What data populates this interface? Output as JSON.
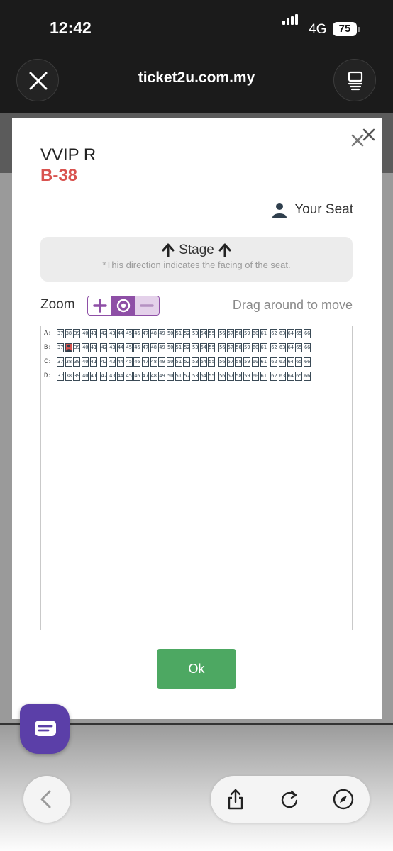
{
  "status_bar": {
    "time": "12:42",
    "network": "4G",
    "battery": "75"
  },
  "browser": {
    "url": "ticket2u.com.my"
  },
  "seat_info": {
    "zone": "VVIP R",
    "seat_code": "B-38"
  },
  "legend": {
    "your_seat_label": "Your Seat"
  },
  "stage": {
    "label": "Stage",
    "note": "*This direction indicates the facing of the seat."
  },
  "zoom": {
    "label": "Zoom",
    "drag_hint": "Drag around to move"
  },
  "seatmap": {
    "rows": [
      {
        "label": "A:",
        "seats": [
          "37",
          "38",
          "39",
          "40",
          "41",
          "42",
          "43",
          "44",
          "45",
          "46",
          "47",
          "48",
          "49",
          "50",
          "51",
          "52",
          "53",
          "54",
          "55",
          "56",
          "57",
          "58",
          "59",
          "60",
          "61",
          "62",
          "63",
          "64",
          "65",
          "66"
        ]
      },
      {
        "label": "B:",
        "seats": [
          "37",
          "38",
          "39",
          "40",
          "41",
          "42",
          "43",
          "44",
          "45",
          "46",
          "47",
          "48",
          "49",
          "50",
          "51",
          "52",
          "53",
          "54",
          "55",
          "56",
          "57",
          "58",
          "59",
          "60",
          "61",
          "62",
          "63",
          "64",
          "65",
          "66"
        ],
        "selected": "38"
      },
      {
        "label": "C:",
        "seats": [
          "37",
          "38",
          "39",
          "40",
          "41",
          "42",
          "43",
          "44",
          "45",
          "46",
          "47",
          "48",
          "49",
          "50",
          "51",
          "52",
          "53",
          "54",
          "55",
          "56",
          "57",
          "58",
          "59",
          "60",
          "61",
          "62",
          "63",
          "64",
          "65",
          "66"
        ]
      },
      {
        "label": "D:",
        "seats": [
          "37",
          "38",
          "39",
          "40",
          "41",
          "42",
          "43",
          "44",
          "45",
          "46",
          "47",
          "48",
          "49",
          "50",
          "51",
          "52",
          "53",
          "54",
          "55",
          "56",
          "57",
          "58",
          "59",
          "60",
          "61",
          "62",
          "63",
          "64",
          "65",
          "66"
        ]
      }
    ]
  },
  "ok_label": "Ok",
  "colors": {
    "accent_purple": "#8e4fa6",
    "seat_red": "#d9534f",
    "ok_green": "#4da862",
    "chat_purple": "#5b3fa8"
  },
  "icons": [
    "close-icon",
    "reader-icon",
    "user-icon",
    "arrow-up-icon",
    "plus-icon",
    "target-icon",
    "minus-icon",
    "chat-icon",
    "chevron-left-icon",
    "share-icon",
    "reload-icon",
    "compass-icon"
  ]
}
